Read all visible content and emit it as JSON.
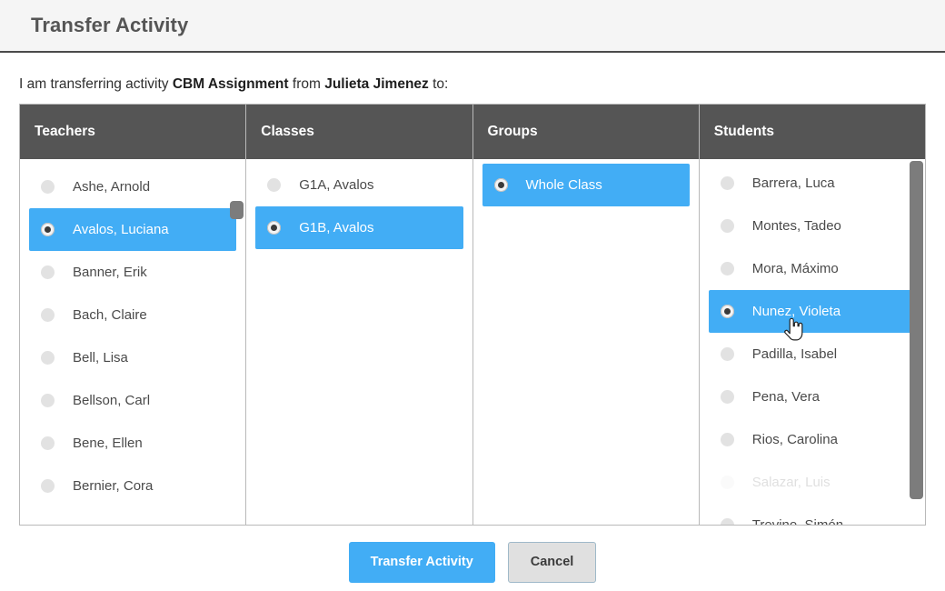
{
  "window": {
    "title": "Transfer Activity"
  },
  "description": {
    "prefix": "I am transferring activity ",
    "activity": "CBM Assignment",
    "middle": " from ",
    "from_teacher": "Julieta Jimenez",
    "suffix": " to:"
  },
  "columns": [
    {
      "key": "teachers",
      "header": "Teachers",
      "has_scrollbar": true,
      "options": [
        {
          "label": "Ashe, Arnold",
          "selected": false
        },
        {
          "label": "Avalos, Luciana",
          "selected": true
        },
        {
          "label": "Banner, Erik",
          "selected": false
        },
        {
          "label": "Bach, Claire",
          "selected": false
        },
        {
          "label": "Bell, Lisa",
          "selected": false
        },
        {
          "label": "Bellson, Carl",
          "selected": false
        },
        {
          "label": "Bene, Ellen",
          "selected": false
        },
        {
          "label": "Bernier, Cora",
          "selected": false
        }
      ]
    },
    {
      "key": "classes",
      "header": "Classes",
      "has_scrollbar": false,
      "options": [
        {
          "label": "G1A, Avalos",
          "selected": false
        },
        {
          "label": "G1B, Avalos",
          "selected": true
        }
      ]
    },
    {
      "key": "groups",
      "header": "Groups",
      "has_scrollbar": false,
      "options": [
        {
          "label": "Whole Class",
          "selected": true
        }
      ]
    },
    {
      "key": "students",
      "header": "Students",
      "has_scrollbar": true,
      "options": [
        {
          "label": "Barrera, Luca",
          "selected": false
        },
        {
          "label": "Montes, Tadeo",
          "selected": false
        },
        {
          "label": "Mora, Máximo",
          "selected": false
        },
        {
          "label": "Nunez, Violeta",
          "selected": true
        },
        {
          "label": "Padilla, Isabel",
          "selected": false
        },
        {
          "label": "Pena, Vera",
          "selected": false
        },
        {
          "label": "Rios, Carolina",
          "selected": false
        },
        {
          "label": "Salazar, Luis",
          "selected": false,
          "ghost": true
        },
        {
          "label": "Trevino, Simón",
          "selected": false
        }
      ]
    }
  ],
  "footer": {
    "submit_label": "Transfer Activity",
    "cancel_label": "Cancel"
  },
  "colors": {
    "accent_blue": "#42adf5",
    "header_gray": "#555555",
    "titlebar_bg": "#f5f5f5",
    "scroll_thumb": "#7c7c7c"
  }
}
